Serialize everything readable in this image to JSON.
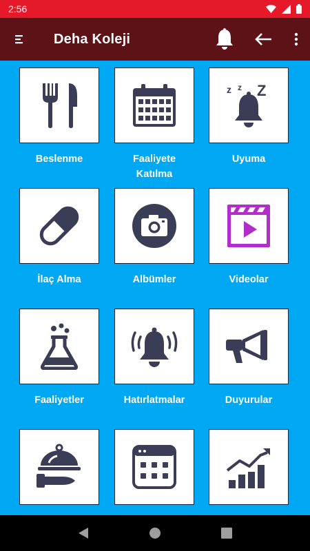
{
  "status_bar": {
    "time": "2:56"
  },
  "app_bar": {
    "title": "Deha Koleji"
  },
  "tiles": [
    {
      "label": "Beslenme",
      "icon": "fork-knife-icon"
    },
    {
      "label": "Faaliyete Katılma",
      "icon": "calendar-icon"
    },
    {
      "label": "Uyuma",
      "icon": "sleeping-bell-icon"
    },
    {
      "label": "İlaç Alma",
      "icon": "pill-icon"
    },
    {
      "label": "Albümler",
      "icon": "camera-icon"
    },
    {
      "label": "Videolar",
      "icon": "video-icon"
    },
    {
      "label": "Faaliyetler",
      "icon": "flask-icon"
    },
    {
      "label": "Hatırlatmalar",
      "icon": "alarm-bell-icon"
    },
    {
      "label": "Duyurular",
      "icon": "megaphone-icon"
    },
    {
      "label": "",
      "icon": "serving-dish-icon"
    },
    {
      "label": "",
      "icon": "calendar-grid-icon"
    },
    {
      "label": "",
      "icon": "bar-chart-icon"
    }
  ],
  "colors": {
    "status_bar": "#e5192a",
    "app_bar": "#5c1216",
    "background": "#00a8f3",
    "icon": "#3b3d56",
    "video_accent": "#b22ec8"
  }
}
